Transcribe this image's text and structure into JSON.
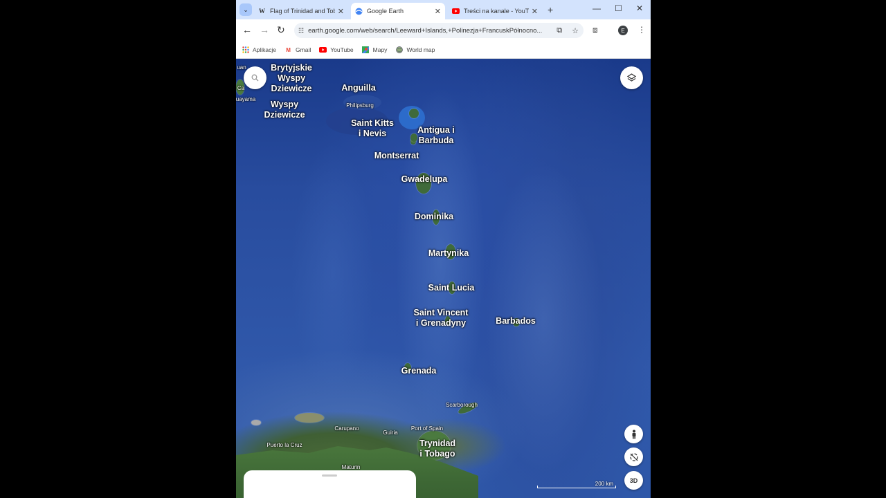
{
  "tabs": [
    {
      "title": "Flag of Trinidad and Tob",
      "icon": "W"
    },
    {
      "title": "Google Earth",
      "icon": "earth"
    },
    {
      "title": "Treści na kanale - YouTu",
      "icon": "youtube"
    }
  ],
  "address": {
    "url": "earth.google.com/web/search/Leeward+Islands,+Polinezja+FrancuskPółnocno..."
  },
  "profile_initial": "E",
  "bookmarks": [
    {
      "label": "Aplikacje",
      "icon": "apps-grid"
    },
    {
      "label": "Gmail",
      "icon": "gmail"
    },
    {
      "label": "YouTube",
      "icon": "youtube"
    },
    {
      "label": "Mapy",
      "icon": "maps-pin"
    },
    {
      "label": "World map",
      "icon": "globe"
    }
  ],
  "map": {
    "labels": {
      "bvi": [
        "Brytyjskie",
        "Wyspy",
        "Dziewicze"
      ],
      "usvi": [
        "Wyspy",
        "Dziewicze"
      ],
      "anguilla": "Anguilla",
      "philipsburg": "Philipsburg",
      "stkitts": [
        "Saint Kitts",
        "i Nevis"
      ],
      "antigua": [
        "Antigua i",
        "Barbuda"
      ],
      "montserrat": "Montserrat",
      "gwadelupa": "Gwadelupa",
      "dominika": "Dominika",
      "martynika": "Martynika",
      "stlucia": "Saint Lucia",
      "stvincent": [
        "Saint Vincent",
        "i Grenadyny"
      ],
      "barbados": "Barbados",
      "grenada": "Grenada",
      "scarborough": "Scarborough",
      "carupano": "Carupano",
      "guiria": "Guiria",
      "portofspain": "Port of Spain",
      "puertolacruz": "Puerto la Cruz",
      "trynidad": [
        "Trynidad",
        "i Tobago"
      ],
      "maturin": "Maturin",
      "edge_uan": "uan",
      "edge_ca": "Ca",
      "edge_uayama": "uayama"
    },
    "scale_label": "200 km",
    "three_d_label": "3D"
  }
}
